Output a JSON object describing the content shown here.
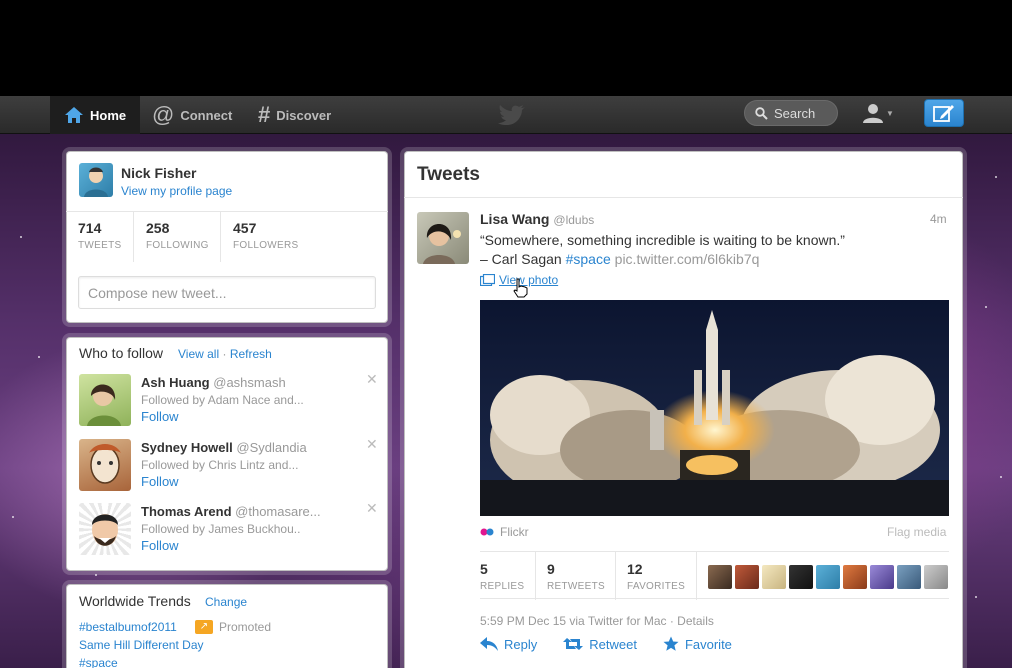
{
  "nav": {
    "home": "Home",
    "connect": "Connect",
    "discover": "Discover",
    "search_label": "Search"
  },
  "profile": {
    "name": "Nick Fisher",
    "link": "View my profile page",
    "stats": [
      {
        "value": "714",
        "label": "TWEETS"
      },
      {
        "value": "258",
        "label": "FOLLOWING"
      },
      {
        "value": "457",
        "label": "FOLLOWERS"
      }
    ],
    "compose_placeholder": "Compose new tweet..."
  },
  "who_to_follow": {
    "title": "Who to follow",
    "view_all": "View all",
    "separator": "·",
    "refresh": "Refresh",
    "close": "✕",
    "items": [
      {
        "name": "Ash Huang",
        "handle": "@ashsmash",
        "followed_by": "Followed by Adam Nace and...",
        "follow": "Follow"
      },
      {
        "name": "Sydney Howell",
        "handle": "@Sydlandia",
        "followed_by": "Followed by Chris Lintz and...",
        "follow": "Follow"
      },
      {
        "name": "Thomas Arend",
        "handle": "@thomasare...",
        "followed_by": "Followed by James Buckhou..",
        "follow": "Follow"
      }
    ]
  },
  "trends": {
    "title": "Worldwide Trends",
    "change": "Change",
    "items": [
      "#bestalbumof2011",
      "Same Hill Different Day",
      "#space"
    ],
    "promoted": "Promoted"
  },
  "tweets": {
    "title": "Tweets",
    "tweet": {
      "name": "Lisa Wang",
      "handle": "@ldubs",
      "time": "4m",
      "line1": "“Somewhere, something incredible is waiting to be known.”",
      "line2_text": "– Carl Sagan ",
      "hashtag": "#space",
      "url": " pic.twitter.com/6l6kib7q",
      "view_photo": "View photo",
      "source": "Flickr",
      "flag": "Flag media",
      "stats": [
        {
          "value": "5",
          "label": "REPLIES"
        },
        {
          "value": "9",
          "label": "RETWEETS"
        },
        {
          "value": "12",
          "label": "FAVORITES"
        }
      ],
      "meta": "5:59 PM Dec 15 via Twitter for Mac · Details",
      "actions": {
        "reply": "Reply",
        "retweet": "Retweet",
        "favorite": "Favorite"
      }
    }
  },
  "colors": {
    "accent": "#2a84cf",
    "topbar": "#2f2f2f",
    "promoted": "#f5a623"
  }
}
